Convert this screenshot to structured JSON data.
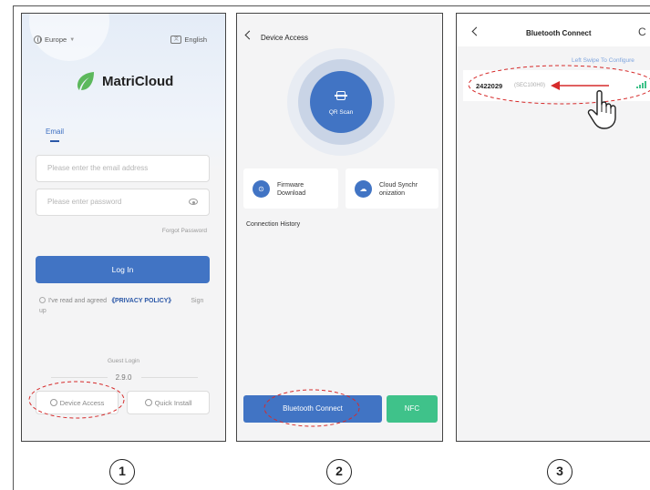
{
  "phone1": {
    "region": "Europe",
    "language": "English",
    "brand": "MatriCloud",
    "tab_email": "Email",
    "email_placeholder": "Please enter the email address",
    "password_placeholder": "Please enter password",
    "forgot": "Forgot Password",
    "login": "Log In",
    "agree_prefix": "I've read and agreed",
    "privacy": "《PRIVACY POLICY》",
    "signup": "Sign up",
    "guest_login": "Guest Login",
    "version": "2.9.0",
    "device_access": "Device Access",
    "quick_install": "Quick Install"
  },
  "phone2": {
    "title": "Device Access",
    "qr_scan": "QR Scan",
    "firmware_l1": "Firmware",
    "firmware_l2": "Download",
    "cloud_l1": "Cloud Synchr",
    "cloud_l2": "onization",
    "connection_history": "Connection History",
    "bluetooth": "Bluetooth Connect",
    "nfc": "NFC"
  },
  "phone3": {
    "title": "Bluetooth Connect",
    "refresh": "C",
    "hint": "Left Swipe  To Configure",
    "device_id": "2422029",
    "device_model": "(SEC100H0)"
  },
  "steps": [
    "1",
    "2",
    "3"
  ],
  "colors": {
    "accent": "#4174c4",
    "nfc": "#3fc28a",
    "annotation": "#d62b2b"
  }
}
